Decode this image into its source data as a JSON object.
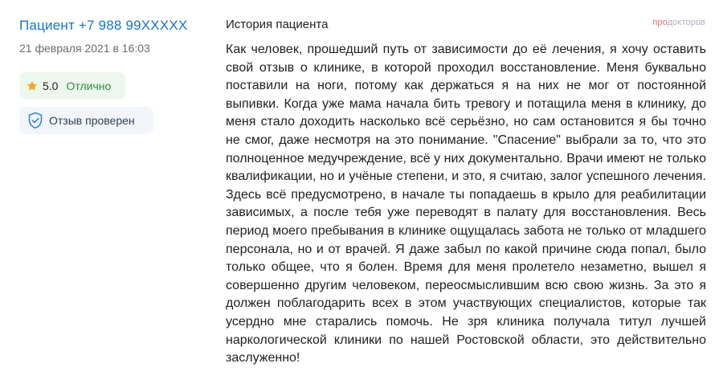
{
  "review": {
    "author": "Пациент +7 988 99XXXXX",
    "date": "21 февраля 2021 в 16:03",
    "rating_value": "5.0",
    "rating_label": "Отлично",
    "verified_label": "Отзыв проверен",
    "section_title": "История пациента",
    "text": "Как человек, прошедший путь от зависимости до её лечения, я хочу оставить свой отзыв о клинике, в которой проходил восстановление. Меня буквально поставили на ноги, потому как держаться я на них не мог от постоянной выпивки. Когда уже мама начала бить тревогу и потащила меня в клинику, до меня стало доходить насколько всё серьёзно, но сам остановится я бы точно не смог, даже несмотря на это понимание. \"Спасение\" выбрали за то, что это полноценное медучреждение, всё у них документально. Врачи имеют не только квалификации, но и учёные степени, и это, я считаю, залог успешного лечения. Здесь всё предусмотрено, в начале ты попадаешь в крыло для реабилитации зависимых, а после тебя уже переводят в палату для восстановления. Весь период моего пребывания в клинике ощущалась забота не только от младшего персонала, но и от врачей. Я даже забыл по какой причине сюда попал, было только общее, что я болен. Время для меня пролетело незаметно, вышел я совершенно другим человеком, переосмыслившим всю свою жизнь. За это я должен поблагодарить всех в этом участвующих специалистов, которые так усердно мне старались помочь. Не зря клиника получала титул лучшей наркологической клиники по нашей Ростовской области, это действительно заслуженно!"
  },
  "brand": {
    "part1": "про",
    "part2": "докторов"
  },
  "icons": {
    "rating": "star-icon",
    "verified": "shield-check-icon"
  },
  "colors": {
    "author_link": "#1a73c9",
    "star": "#f5a623",
    "rating_label": "#2e8b3d",
    "rating_bg": "#edf7ee",
    "verified_bg": "#f2f6fb",
    "shield": "#2b7de0",
    "brand_pro": "#f06b6b",
    "brand_doc": "#a9b0bb"
  }
}
